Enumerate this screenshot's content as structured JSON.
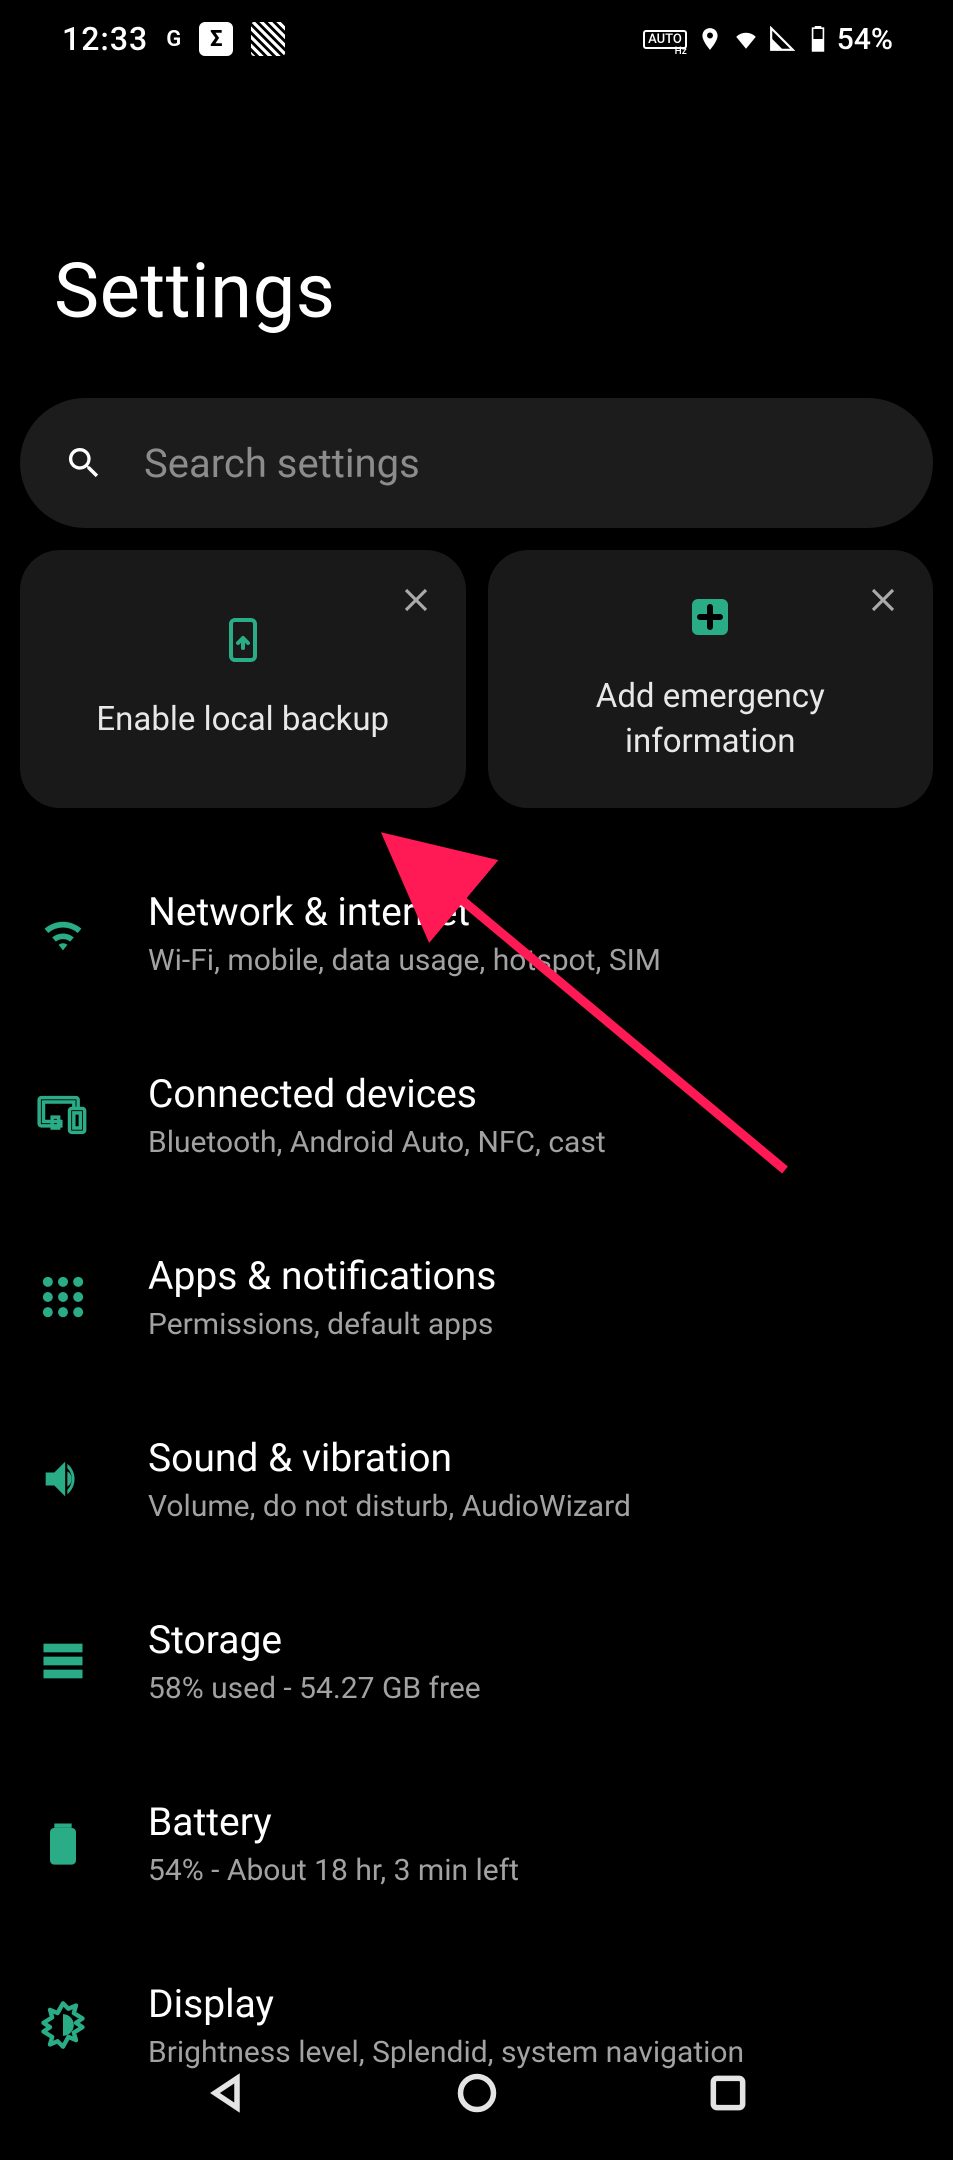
{
  "status": {
    "time": "12:33",
    "battery_pct": "54%"
  },
  "page_title": "Settings",
  "search": {
    "placeholder": "Search settings"
  },
  "cards": [
    {
      "label": "Enable local backup"
    },
    {
      "label": "Add emergency information"
    }
  ],
  "list": [
    {
      "title": "Network & internet",
      "sub": "Wi-Fi, mobile, data usage, hotspot, SIM"
    },
    {
      "title": "Connected devices",
      "sub": "Bluetooth, Android Auto, NFC, cast"
    },
    {
      "title": "Apps & notifications",
      "sub": "Permissions, default apps"
    },
    {
      "title": "Sound & vibration",
      "sub": "Volume, do not disturb, AudioWizard"
    },
    {
      "title": "Storage",
      "sub": "58% used - 54.27 GB free"
    },
    {
      "title": "Battery",
      "sub": "54% - About 18 hr, 3 min left"
    },
    {
      "title": "Display",
      "sub": "Brightness level, Splendid, system navigation"
    }
  ]
}
